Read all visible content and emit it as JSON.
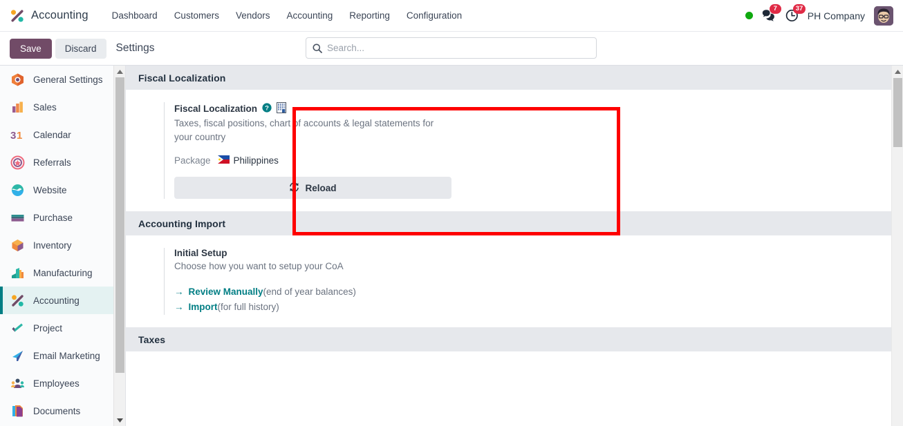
{
  "navbar": {
    "brand": "Accounting",
    "brand_icon": "accounting-app-icon",
    "links": [
      {
        "label": "Dashboard"
      },
      {
        "label": "Customers"
      },
      {
        "label": "Vendors"
      },
      {
        "label": "Accounting"
      },
      {
        "label": "Reporting"
      },
      {
        "label": "Configuration"
      }
    ],
    "status_indicator": "online-dot",
    "messages": {
      "icon": "chat-bubble-icon",
      "count": "7"
    },
    "activities": {
      "icon": "clock-icon",
      "count": "37"
    },
    "company": "PH Company",
    "avatar_icon": "user-avatar"
  },
  "control_panel": {
    "save_label": "Save",
    "discard_label": "Discard",
    "title": "Settings"
  },
  "search": {
    "placeholder": "Search...",
    "value": "",
    "icon": "search-icon"
  },
  "sidebar": {
    "items": [
      {
        "label": "General Settings",
        "icon": "general-settings-icon",
        "active": false
      },
      {
        "label": "Sales",
        "icon": "sales-icon",
        "active": false
      },
      {
        "label": "Calendar",
        "icon": "calendar-icon",
        "active": false
      },
      {
        "label": "Referrals",
        "icon": "referrals-icon",
        "active": false
      },
      {
        "label": "Website",
        "icon": "website-icon",
        "active": false
      },
      {
        "label": "Purchase",
        "icon": "purchase-icon",
        "active": false
      },
      {
        "label": "Inventory",
        "icon": "inventory-icon",
        "active": false
      },
      {
        "label": "Manufacturing",
        "icon": "manufacturing-icon",
        "active": false
      },
      {
        "label": "Accounting",
        "icon": "accounting-icon",
        "active": true
      },
      {
        "label": "Project",
        "icon": "project-icon",
        "active": false
      },
      {
        "label": "Email Marketing",
        "icon": "email-marketing-icon",
        "active": false
      },
      {
        "label": "Employees",
        "icon": "employees-icon",
        "active": false
      },
      {
        "label": "Documents",
        "icon": "documents-icon",
        "active": false
      }
    ]
  },
  "sections": {
    "fiscal_localization": {
      "header": "Fiscal Localization",
      "setting_title": "Fiscal Localization",
      "help_icon": "help-question-icon",
      "company_icon": "company-building-icon",
      "description": "Taxes, fiscal positions, chart of accounts & legal statements for your country",
      "field_label": "Package",
      "field_value": "Philippines",
      "field_flag": "philippines-flag",
      "reload_label": "Reload",
      "reload_icon": "refresh-icon"
    },
    "accounting_import": {
      "header": "Accounting Import",
      "setting_title": "Initial Setup",
      "description": "Choose how you want to setup your CoA",
      "links": [
        {
          "label": "Review Manually",
          "note": "(end of year balances)",
          "arrow": "→"
        },
        {
          "label": "Import",
          "note": "(for full history)",
          "arrow": "→"
        }
      ]
    },
    "taxes": {
      "header": "Taxes"
    }
  },
  "colors": {
    "accent_teal": "#017e84",
    "brand_purple": "#714b67",
    "highlight_red": "#fe0000",
    "badge_red": "#e02b46",
    "online_green": "#0fa90f"
  }
}
